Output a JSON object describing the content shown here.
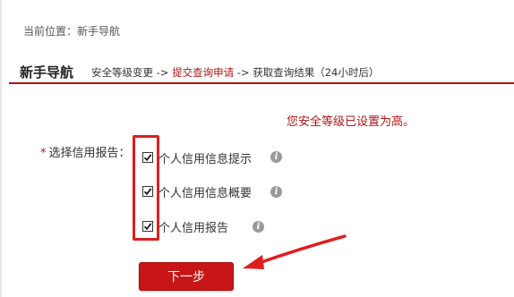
{
  "breadcrumb": {
    "label": "当前位置：",
    "current": "新手导航"
  },
  "guide": {
    "title": "新手导航",
    "step1": "安全等级变更",
    "sep1": " -> ",
    "step2": "提交查询申请",
    "sep2": " -> ",
    "step3": "获取查询结果（24小时后）"
  },
  "notice": "您安全等级已设置为高。",
  "form": {
    "required_mark": "*",
    "label": "选择信用报告："
  },
  "options": [
    {
      "label": "个人信用信息提示",
      "checked": true,
      "info_icon": "info-icon"
    },
    {
      "label": "个人信用信息概要",
      "checked": true,
      "info_icon": "info-icon"
    },
    {
      "label": "个人信用报告",
      "checked": true,
      "info_icon": "info-icon"
    }
  ],
  "info_glyph": "i",
  "next_button": "下一步",
  "colors": {
    "accent": "#b01515",
    "button": "#c81616",
    "annotation": "#e01d1d",
    "info_icon": "#9a9a9a"
  }
}
